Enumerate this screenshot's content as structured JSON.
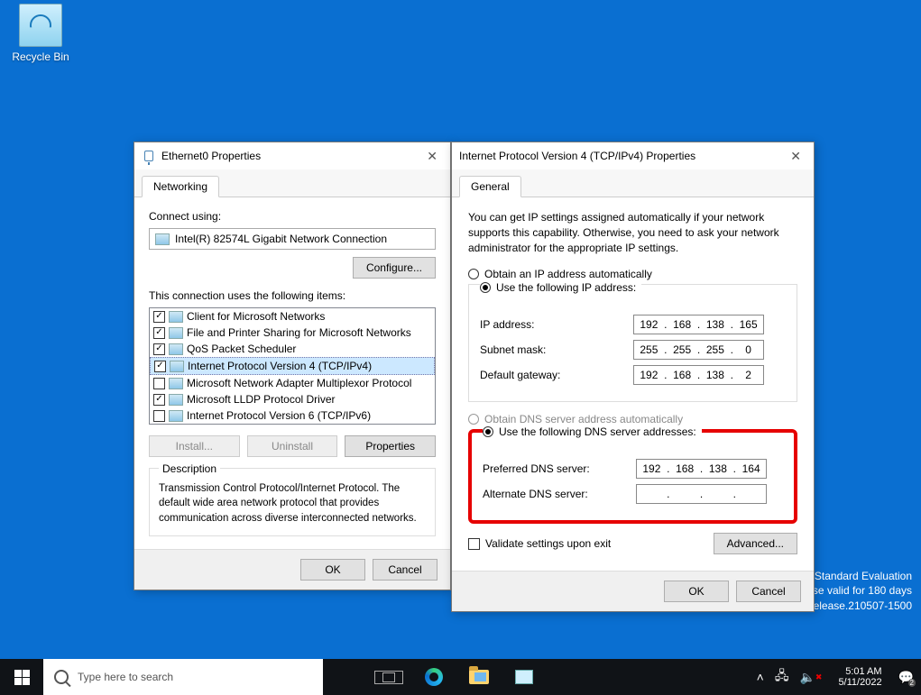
{
  "desktop": {
    "recycle_bin": "Recycle Bin"
  },
  "watermark": {
    "line1": "Windows Server 2022 Standard Evaluation",
    "line2": "Windows License valid for 180 days",
    "line3": "Build 20348.fe_release.210507-1500"
  },
  "taskbar": {
    "search_placeholder": "Type here to search",
    "clock_time": "5:01 AM",
    "clock_date": "5/11/2022"
  },
  "eth_dialog": {
    "title": "Ethernet0 Properties",
    "tab": "Networking",
    "connect_using": "Connect using:",
    "adapter": "Intel(R) 82574L Gigabit Network Connection",
    "configure": "Configure...",
    "items_label": "This connection uses the following items:",
    "items": [
      {
        "checked": true,
        "label": "Client for Microsoft Networks"
      },
      {
        "checked": true,
        "label": "File and Printer Sharing for Microsoft Networks"
      },
      {
        "checked": true,
        "label": "QoS Packet Scheduler"
      },
      {
        "checked": true,
        "label": "Internet Protocol Version 4 (TCP/IPv4)",
        "selected": true
      },
      {
        "checked": false,
        "label": "Microsoft Network Adapter Multiplexor Protocol"
      },
      {
        "checked": true,
        "label": "Microsoft LLDP Protocol Driver"
      },
      {
        "checked": false,
        "label": "Internet Protocol Version 6 (TCP/IPv6)"
      }
    ],
    "install": "Install...",
    "uninstall": "Uninstall",
    "properties": "Properties",
    "desc_title": "Description",
    "desc_text": "Transmission Control Protocol/Internet Protocol. The default wide area network protocol that provides communication across diverse interconnected networks.",
    "ok": "OK",
    "cancel": "Cancel"
  },
  "ip_dialog": {
    "title": "Internet Protocol Version 4 (TCP/IPv4) Properties",
    "tab": "General",
    "info": "You can get IP settings assigned automatically if your network supports this capability. Otherwise, you need to ask your network administrator for the appropriate IP settings.",
    "auto_ip": "Obtain an IP address automatically",
    "manual_ip": "Use the following IP address:",
    "ip_label": "IP address:",
    "ip_value": [
      "192",
      "168",
      "138",
      "165"
    ],
    "subnet_label": "Subnet mask:",
    "subnet_value": [
      "255",
      "255",
      "255",
      "0"
    ],
    "gateway_label": "Default gateway:",
    "gateway_value": [
      "192",
      "168",
      "138",
      "2"
    ],
    "auto_dns": "Obtain DNS server address automatically",
    "manual_dns": "Use the following DNS server addresses:",
    "pref_dns_label": "Preferred DNS server:",
    "pref_dns_value": [
      "192",
      "168",
      "138",
      "164"
    ],
    "alt_dns_label": "Alternate DNS server:",
    "alt_dns_value": [
      "",
      "",
      "",
      ""
    ],
    "validate": "Validate settings upon exit",
    "advanced": "Advanced...",
    "ok": "OK",
    "cancel": "Cancel"
  }
}
